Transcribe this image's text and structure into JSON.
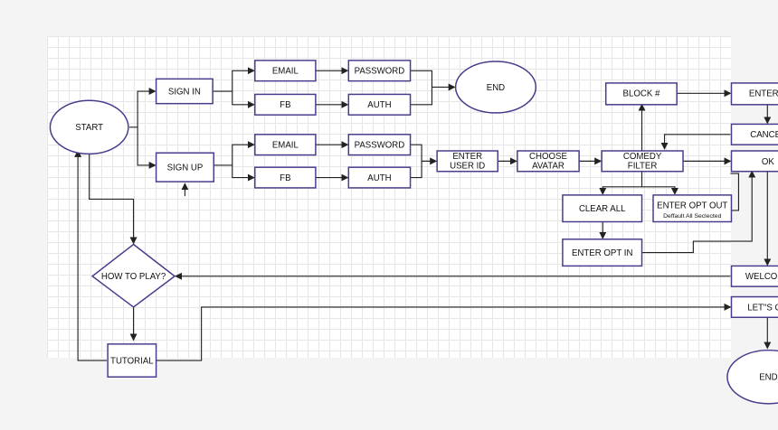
{
  "diagram": {
    "nodes": {
      "start": "START",
      "sign_in": "SIGN IN",
      "sign_up": "SIGN UP",
      "email_in": "EMAIL",
      "password_in": "PASSWORD",
      "fb_in": "FB",
      "auth_in": "AUTH",
      "end_top": "END",
      "email_up": "EMAIL",
      "password_up": "PASSWORD",
      "fb_up": "FB",
      "auth_up": "AUTH",
      "enter_user_id": [
        "ENTER",
        "USER ID"
      ],
      "choose_avatar": [
        "CHOOSE",
        "AVATAR"
      ],
      "comedy_filter": [
        "COMEDY",
        "FILTER"
      ],
      "block": "BLOCK #",
      "enter_num": "ENTER #",
      "cancel": "CANCEL",
      "ok": "OK",
      "clear_all": "CLEAR ALL",
      "enter_opt_out": "ENTER  OPT OUT",
      "enter_opt_out_note": "Deffault All Seclected",
      "enter_opt_in": "ENTER OPT IN",
      "how_to_play": "HOW TO PLAY?",
      "welcome": "WELCOME",
      "lets_go": "LET\"S GO",
      "tutorial": "TUTORIAL",
      "end_bottom": "END"
    }
  }
}
